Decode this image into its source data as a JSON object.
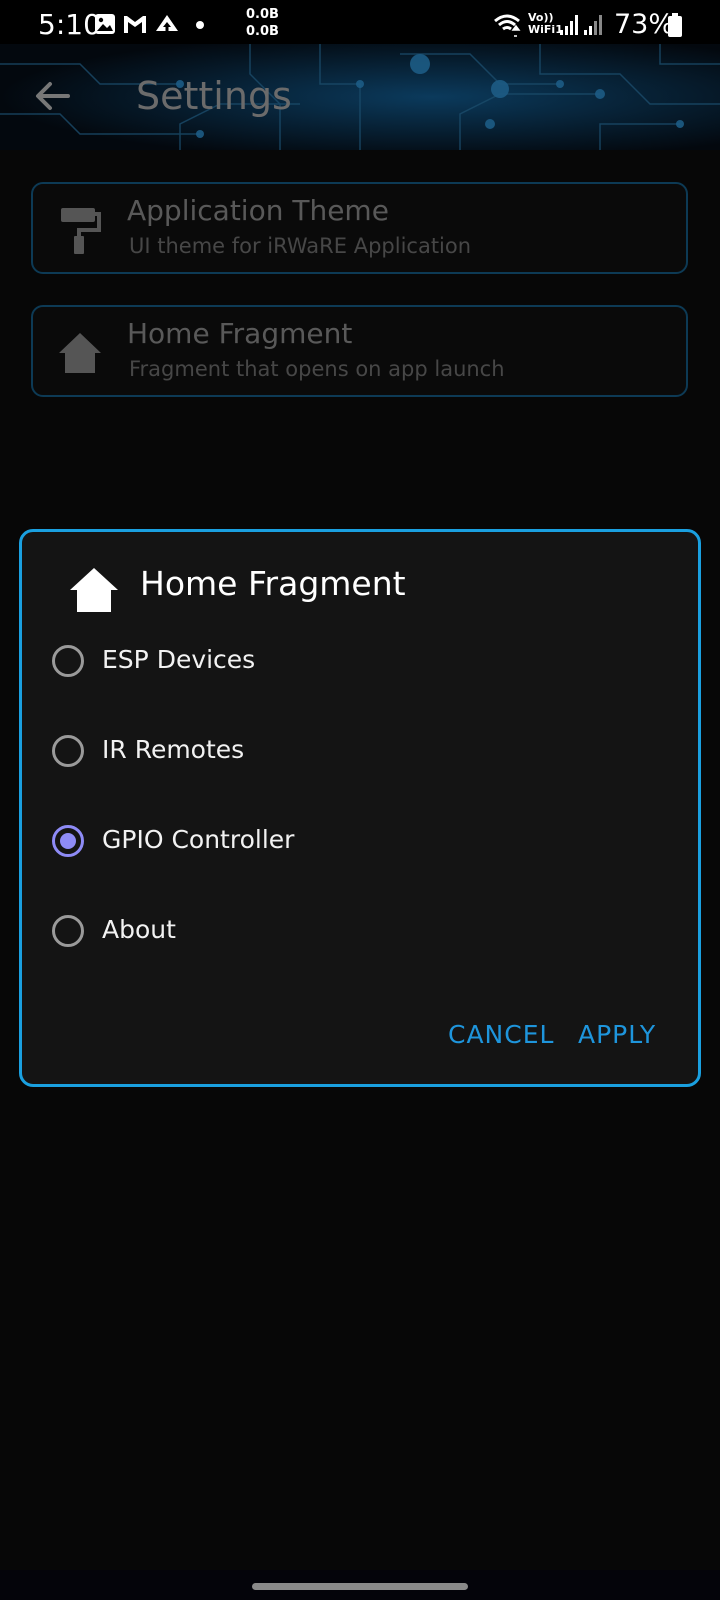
{
  "status_bar": {
    "time": "5:10",
    "speed_up": "0.0B",
    "speed_down": "0.0B",
    "network_label_top": "Vo))",
    "network_label_bottom": "WiFi1",
    "battery": "73%"
  },
  "app_bar": {
    "title": "Settings"
  },
  "settings": [
    {
      "title": "Application Theme",
      "subtitle": "UI theme for iRWaRE Application",
      "icon": "paint-roller-icon"
    },
    {
      "title": "Home Fragment",
      "subtitle": "Fragment that opens on app launch",
      "icon": "home-icon"
    }
  ],
  "dialog": {
    "title": "Home Fragment",
    "icon": "home-icon",
    "options": [
      {
        "label": "ESP Devices",
        "checked": false
      },
      {
        "label": "IR Remotes",
        "checked": false
      },
      {
        "label": "GPIO Controller",
        "checked": true
      },
      {
        "label": "About",
        "checked": false
      }
    ],
    "cancel_label": "CANCEL",
    "apply_label": "APPLY"
  },
  "colors": {
    "accent": "#1e95dc",
    "radio_checked": "#8e8bf6",
    "dialog_border": "#1aa0e0"
  }
}
